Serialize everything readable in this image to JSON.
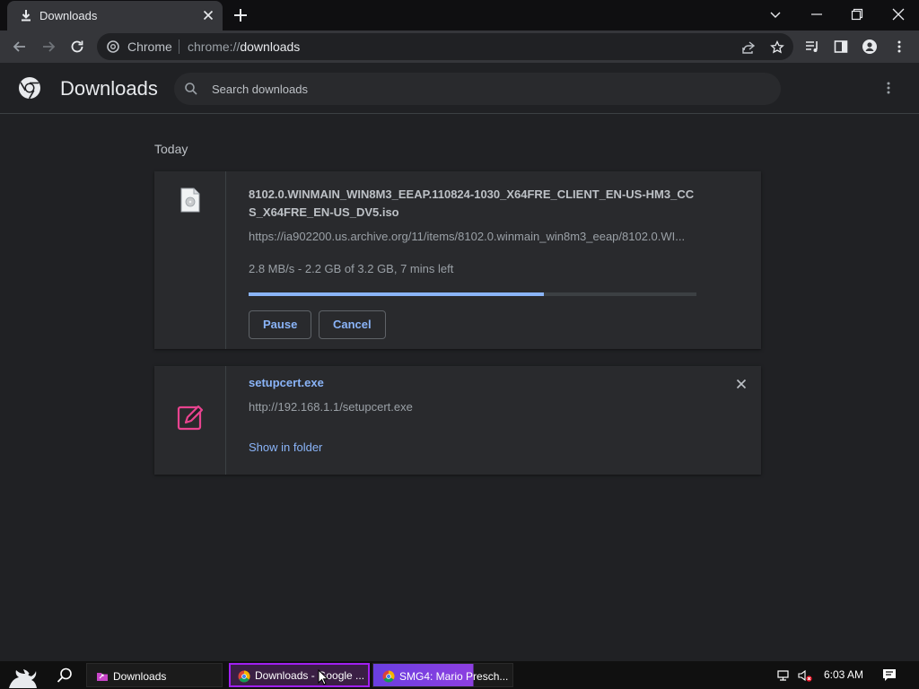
{
  "browser": {
    "tab": {
      "title": "Downloads",
      "icon": "download-icon"
    },
    "omnibox": {
      "site_label": "Chrome",
      "url_prefix": "chrome://",
      "url_path": "downloads"
    }
  },
  "page": {
    "title": "Downloads",
    "search": {
      "placeholder": "Search downloads"
    },
    "section_label": "Today"
  },
  "downloads": [
    {
      "file_name": "8102.0.WINMAIN_WIN8M3_EEAP.110824-1030_X64FRE_CLIENT_EN-US-HM3_CCS_X64FRE_EN-US_DV5.iso",
      "url": "https://ia902200.us.archive.org/11/items/8102.0.winmain_win8m3_eeap/8102.0.WI...",
      "status": "2.8 MB/s - 2.2 GB of 3.2 GB, 7 mins left",
      "progress_fraction": 0.66,
      "actions": {
        "pause": "Pause",
        "cancel": "Cancel"
      }
    },
    {
      "file_name": "setupcert.exe",
      "url": "http://192.168.1.1/setupcert.exe",
      "action_link": "Show in folder"
    }
  ],
  "taskbar": {
    "items": [
      {
        "label": "Downloads"
      },
      {
        "label": "Downloads - Google ..."
      },
      {
        "label": "SMG4: Mario Presch..."
      }
    ],
    "clock": "6:03 AM"
  },
  "colors": {
    "accent": "#8ab4f8",
    "background": "#202124",
    "card": "#292a2d",
    "taskbar_highlight": "#a020f0"
  }
}
